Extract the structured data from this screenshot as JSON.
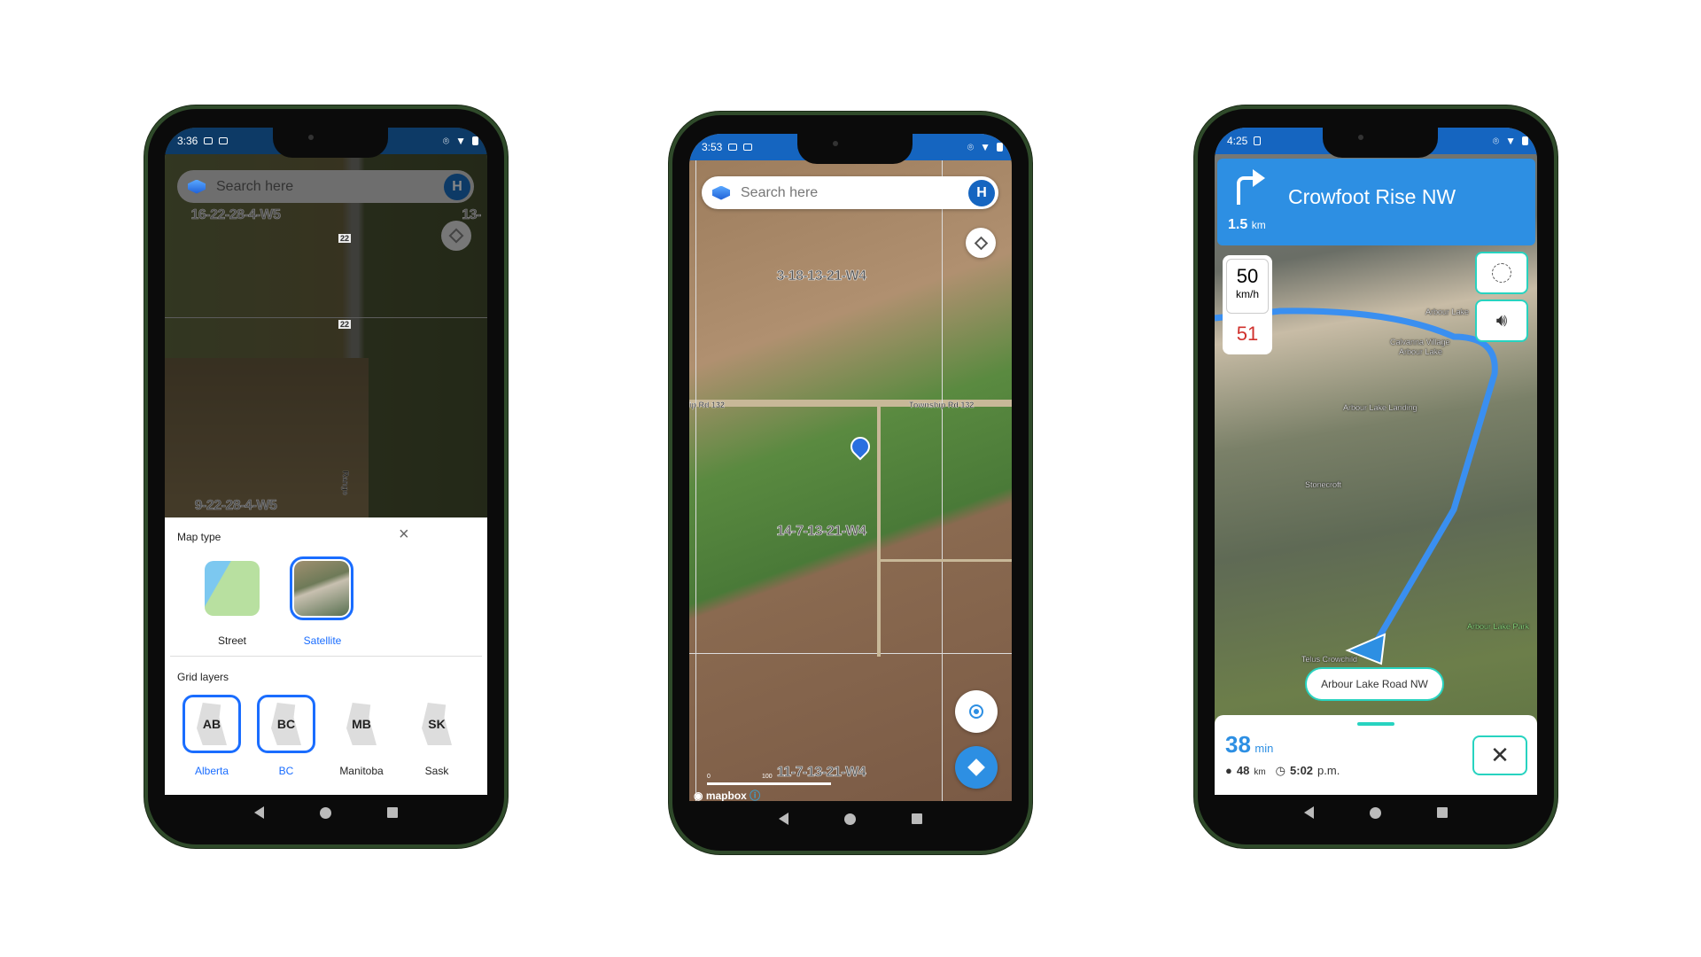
{
  "colors": {
    "accent": "#1a6dff",
    "nav_blue": "#2d8fe3",
    "teal": "#27d3c0",
    "status_dark": "#0d3a66",
    "status_blue": "#1565c0",
    "speed_red": "#d0312d"
  },
  "phone1": {
    "status": {
      "time": "3:36"
    },
    "search": {
      "placeholder": "Search here",
      "avatar": "H"
    },
    "map_labels": {
      "grid_a": "16-22-28-4-W5",
      "grid_b": "13-",
      "grid_c": "9-22-28-4-W5",
      "hwy_a": "22",
      "hwy_b": "22",
      "road": "Range"
    },
    "sheet": {
      "map_type_title": "Map type",
      "map_types": [
        {
          "label": "Street",
          "selected": false
        },
        {
          "label": "Satellite",
          "selected": true
        }
      ],
      "grid_title": "Grid layers",
      "grid_layers": [
        {
          "code": "AB",
          "label": "Alberta",
          "selected": true
        },
        {
          "code": "BC",
          "label": "BC",
          "selected": true
        },
        {
          "code": "MB",
          "label": "Manitoba",
          "selected": false
        },
        {
          "code": "SK",
          "label": "Sask",
          "selected": false
        }
      ]
    }
  },
  "phone2": {
    "status": {
      "time": "3:53"
    },
    "search": {
      "placeholder": "Search here",
      "avatar": "H"
    },
    "map_labels": {
      "grid_a": "3-18-13-21-W4",
      "grid_b": "14-7-13-21-W4",
      "grid_c": "11-7-13-21-W4",
      "road_left": "ip Rd 132",
      "road_right": "Township Rd 132"
    },
    "scale": {
      "start": "0",
      "mid": "100"
    },
    "attribution": "mapbox"
  },
  "phone3": {
    "status": {
      "time": "4:25"
    },
    "banner": {
      "street": "Crowfoot Rise NW",
      "distance": "1.5",
      "distance_unit": "km"
    },
    "speed": {
      "limit": "50",
      "unit": "km/h",
      "current": "51"
    },
    "map_labels": {
      "a": "Arbour Lake",
      "b": "Calvanna Village",
      "c": "Arbour Lake",
      "d": "Arbour Lake Landing",
      "e": "Stonecroft",
      "f": "Telus Crowchild",
      "g": "Arbour Lake Park"
    },
    "current_road": "Arbour Lake Road NW",
    "trip": {
      "duration": "38",
      "duration_unit": "min",
      "distance": "48",
      "distance_unit": "km",
      "eta": "5:02",
      "eta_suffix": "p.m."
    }
  }
}
